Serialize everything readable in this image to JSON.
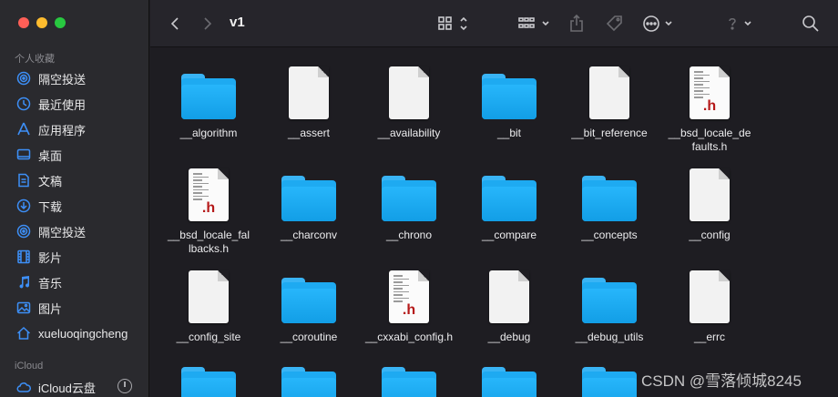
{
  "toolbar": {
    "title": "v1"
  },
  "sidebar": {
    "favorites_header": "个人收藏",
    "favorites": [
      {
        "label": "隔空投送",
        "icon": "airdrop-icon"
      },
      {
        "label": "最近使用",
        "icon": "clock-icon"
      },
      {
        "label": "应用程序",
        "icon": "apps-icon"
      },
      {
        "label": "桌面",
        "icon": "desktop-icon"
      },
      {
        "label": "文稿",
        "icon": "document-icon"
      },
      {
        "label": "下载",
        "icon": "download-icon"
      },
      {
        "label": "隔空投送",
        "icon": "airdrop-icon"
      },
      {
        "label": "影片",
        "icon": "film-icon"
      },
      {
        "label": "音乐",
        "icon": "music-icon"
      },
      {
        "label": "图片",
        "icon": "photo-icon"
      },
      {
        "label": "xueluoqingcheng",
        "icon": "home-icon"
      }
    ],
    "icloud_header": "iCloud",
    "icloud": [
      {
        "label": "iCloud云盘",
        "icon": "cloud-icon"
      }
    ]
  },
  "files": [
    {
      "name": "__algorithm",
      "kind": "folder"
    },
    {
      "name": "__assert",
      "kind": "file"
    },
    {
      "name": "__availability",
      "kind": "file"
    },
    {
      "name": "__bit",
      "kind": "folder"
    },
    {
      "name": "__bit_reference",
      "kind": "file"
    },
    {
      "name": "__bsd_locale_defaults.h",
      "kind": "header",
      "ext": ".h"
    },
    {
      "name": "__bsd_locale_fallbacks.h",
      "kind": "header",
      "ext": ".h"
    },
    {
      "name": "__charconv",
      "kind": "folder"
    },
    {
      "name": "__chrono",
      "kind": "folder"
    },
    {
      "name": "__compare",
      "kind": "folder"
    },
    {
      "name": "__concepts",
      "kind": "folder"
    },
    {
      "name": "__config",
      "kind": "file"
    },
    {
      "name": "__config_site",
      "kind": "file"
    },
    {
      "name": "__coroutine",
      "kind": "folder"
    },
    {
      "name": "__cxxabi_config.h",
      "kind": "header",
      "ext": ".h"
    },
    {
      "name": "__debug",
      "kind": "file"
    },
    {
      "name": "__debug_utils",
      "kind": "folder"
    },
    {
      "name": "__errc",
      "kind": "file"
    }
  ],
  "watermark": "CSDN @雪落倾城8245"
}
